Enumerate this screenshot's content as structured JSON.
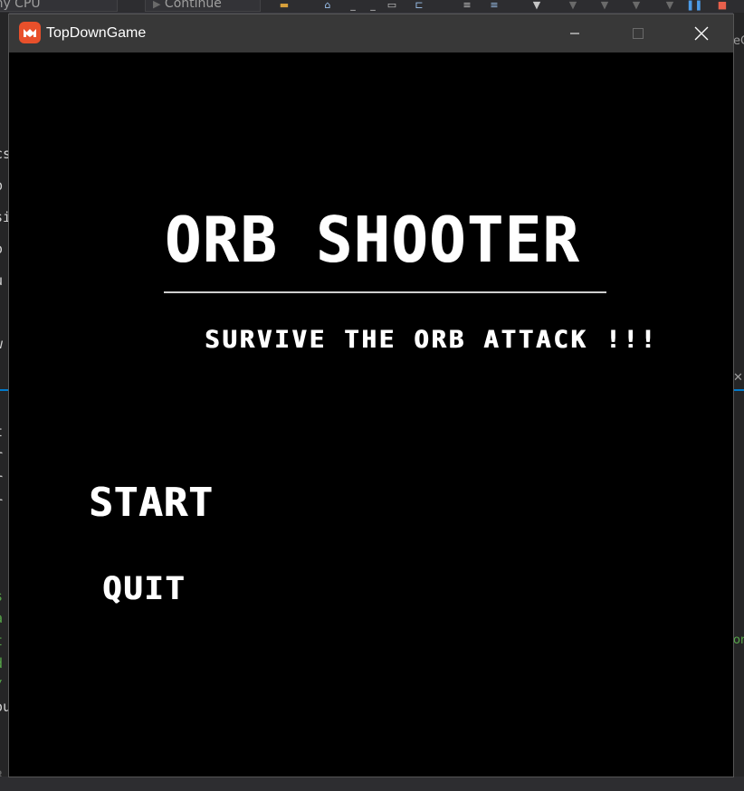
{
  "ide": {
    "config_dropdown": "Any CPU",
    "continue_label": "Continue",
    "left_fragments": [
      "cs",
      "p",
      "si",
      "o",
      "u",
      "w",
      "t",
      "r",
      "r",
      "r",
      "s",
      "a",
      "t",
      "d",
      "/",
      "ou",
      "3"
    ],
    "right_fragments": [
      "eC",
      "on"
    ]
  },
  "window": {
    "title": "TopDownGame",
    "minimize_icon": "minimize-icon",
    "maximize_icon": "maximize-icon",
    "close_icon": "close-icon",
    "app_icon": "monogame-logo-icon",
    "app_icon_color": "#e8502b"
  },
  "game": {
    "title": "ORB SHOOTER",
    "subtitle": "SURVIVE THE ORB ATTACK !!!",
    "menu": {
      "start": "START",
      "quit": "QUIT"
    },
    "background_color": "#000000",
    "text_color": "#ffffff"
  }
}
